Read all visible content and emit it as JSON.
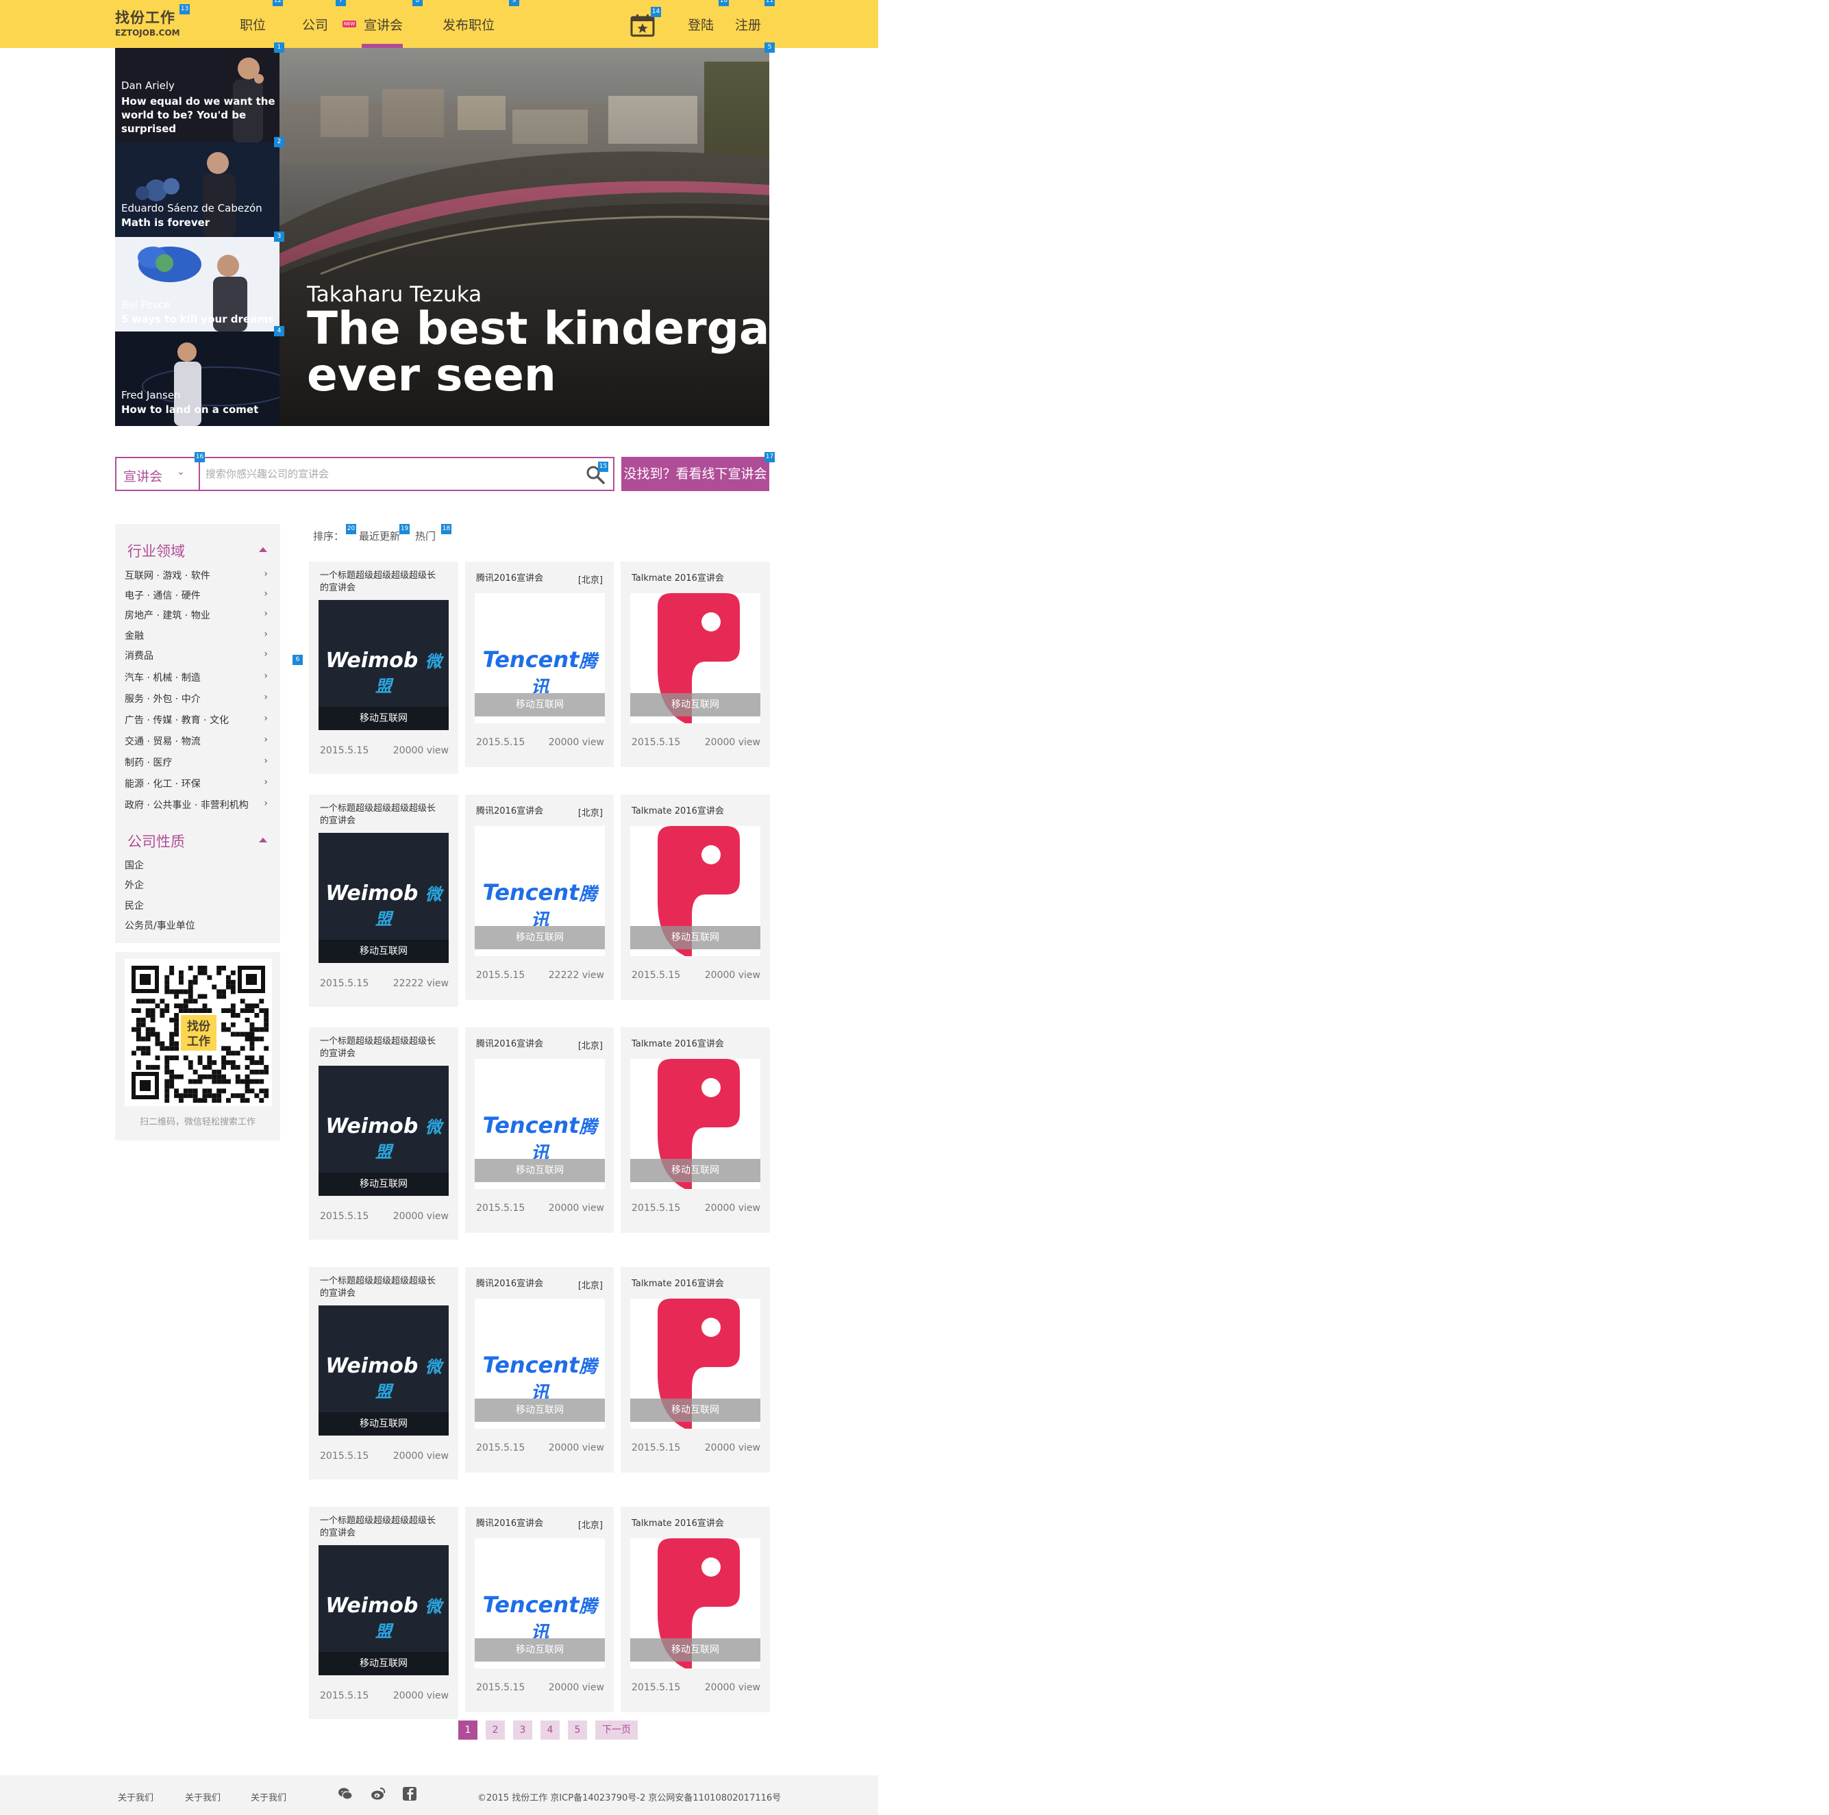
{
  "header": {
    "logo_cn": "找份工作",
    "logo_en": "EZTOJOB.COM",
    "nav": [
      "职位",
      "公司",
      "宣讲会",
      "发布职位"
    ],
    "new_badge": "NEW",
    "login": "登陆",
    "register": "注册",
    "accent": "#fcd64f"
  },
  "hero": {
    "talks": [
      {
        "speaker": "Dan Ariely",
        "title": "How equal do we want the world to be? You'd be surprised"
      },
      {
        "speaker": "Eduardo Sáenz de Cabezón",
        "title": "Math is forever"
      },
      {
        "speaker": "Bel Pesce",
        "title": "5 ways to kill your dreams"
      },
      {
        "speaker": "Fred Jansen",
        "title": "How to land on a comet"
      }
    ],
    "main_speaker": "Takaharu Tezuka",
    "main_title_line1": "The best kindergarten",
    "main_title_line2": "ever seen"
  },
  "search": {
    "select_value": "宣讲会",
    "placeholder": "搜索你感兴趣公司的宣讲会",
    "offline_button": "没找到？看看线下宣讲会"
  },
  "sidebar": {
    "industry_title": "行业领域",
    "industries": [
      "互联网 · 游戏 · 软件",
      "电子 · 通信 · 硬件",
      "房地产 · 建筑 · 物业",
      "金融",
      "消费品",
      "汽车 · 机械 · 制造",
      "服务 · 外包 · 中介",
      "广告 · 传媒 · 教育 · 文化",
      "交通 · 贸易 · 物流",
      "制药 · 医疗",
      "能源 · 化工 · 环保",
      "政府 · 公共事业 · 非营利机构"
    ],
    "nature_title": "公司性质",
    "natures": [
      "国企",
      "外企",
      "民企",
      "公务员/事业单位"
    ],
    "qr_badge_line1": "找份",
    "qr_badge_line2": "工作",
    "qr_caption": "扫二维码，微信轻松搜索工作"
  },
  "sort": {
    "label": "排序：",
    "options": [
      "最近更新",
      "热门"
    ]
  },
  "cards": [
    [
      {
        "title_line1": "一个标题超级超级超级超级长",
        "title_line2": "的宣讲会",
        "logo": "Weimob",
        "logo_cn": "微盟",
        "category": "移动互联网",
        "date": "2015.5.15",
        "views": "20000 view"
      },
      {
        "title_line1": "腾讯2016宣讲会",
        "city": "[北京]",
        "logo": "Tencent",
        "logo_cn": "腾讯",
        "category": "移动互联网",
        "date": "2015.5.15",
        "views": "20000 view"
      },
      {
        "title_line1": "Talkmate 2016宣讲会",
        "category": "移动互联网",
        "date": "2015.5.15",
        "views": "20000 view"
      }
    ],
    [
      {
        "title_line1": "一个标题超级超级超级超级长",
        "title_line2": "的宣讲会",
        "logo": "Weimob",
        "logo_cn": "微盟",
        "category": "移动互联网",
        "date": "2015.5.15",
        "views": "22222 view"
      },
      {
        "title_line1": "腾讯2016宣讲会",
        "city": "[北京]",
        "logo": "Tencent",
        "logo_cn": "腾讯",
        "category": "移动互联网",
        "date": "2015.5.15",
        "views": "22222 view"
      },
      {
        "title_line1": "Talkmate 2016宣讲会",
        "category": "移动互联网",
        "date": "2015.5.15",
        "views": "20000 view"
      }
    ],
    [
      {
        "title_line1": "一个标题超级超级超级超级长",
        "title_line2": "的宣讲会",
        "logo": "Weimob",
        "logo_cn": "微盟",
        "category": "移动互联网",
        "date": "2015.5.15",
        "views": "20000 view"
      },
      {
        "title_line1": "腾讯2016宣讲会",
        "city": "[北京]",
        "logo": "Tencent",
        "logo_cn": "腾讯",
        "category": "移动互联网",
        "date": "2015.5.15",
        "views": "20000 view"
      },
      {
        "title_line1": "Talkmate 2016宣讲会",
        "category": "移动互联网",
        "date": "2015.5.15",
        "views": "20000 view"
      }
    ],
    [
      {
        "title_line1": "一个标题超级超级超级超级长",
        "title_line2": "的宣讲会",
        "logo": "Weimob",
        "logo_cn": "微盟",
        "category": "移动互联网",
        "date": "2015.5.15",
        "views": "20000 view"
      },
      {
        "title_line1": "腾讯2016宣讲会",
        "city": "[北京]",
        "logo": "Tencent",
        "logo_cn": "腾讯",
        "category": "移动互联网",
        "date": "2015.5.15",
        "views": "20000 view"
      },
      {
        "title_line1": "Talkmate 2016宣讲会",
        "category": "移动互联网",
        "date": "2015.5.15",
        "views": "20000 view"
      }
    ],
    [
      {
        "title_line1": "一个标题超级超级超级超级长",
        "title_line2": "的宣讲会",
        "logo": "Weimob",
        "logo_cn": "微盟",
        "category": "移动互联网",
        "date": "2015.5.15",
        "views": "20000 view"
      },
      {
        "title_line1": "腾讯2016宣讲会",
        "city": "[北京]",
        "logo": "Tencent",
        "logo_cn": "腾讯",
        "category": "移动互联网",
        "date": "2015.5.15",
        "views": "20000 view"
      },
      {
        "title_line1": "Talkmate 2016宣讲会",
        "category": "移动互联网",
        "date": "2015.5.15",
        "views": "20000 view"
      }
    ]
  ],
  "pagination": {
    "pages": [
      "1",
      "2",
      "3",
      "4",
      "5"
    ],
    "current": "1",
    "next": "下一页"
  },
  "footer": {
    "links": [
      "关于我们",
      "关于我们",
      "关于我们"
    ],
    "icons": [
      "wechat-icon",
      "weibo-icon",
      "facebook-icon"
    ],
    "copyright": "©2015 找份工作 京ICP备14023790号-2 京公网安备11010802017116号"
  },
  "markers": [
    "1",
    "2",
    "3",
    "4",
    "5",
    "6",
    "7",
    "8",
    "9",
    "10",
    "11",
    "12",
    "13",
    "14",
    "15",
    "16",
    "17",
    "18",
    "19",
    "20"
  ]
}
